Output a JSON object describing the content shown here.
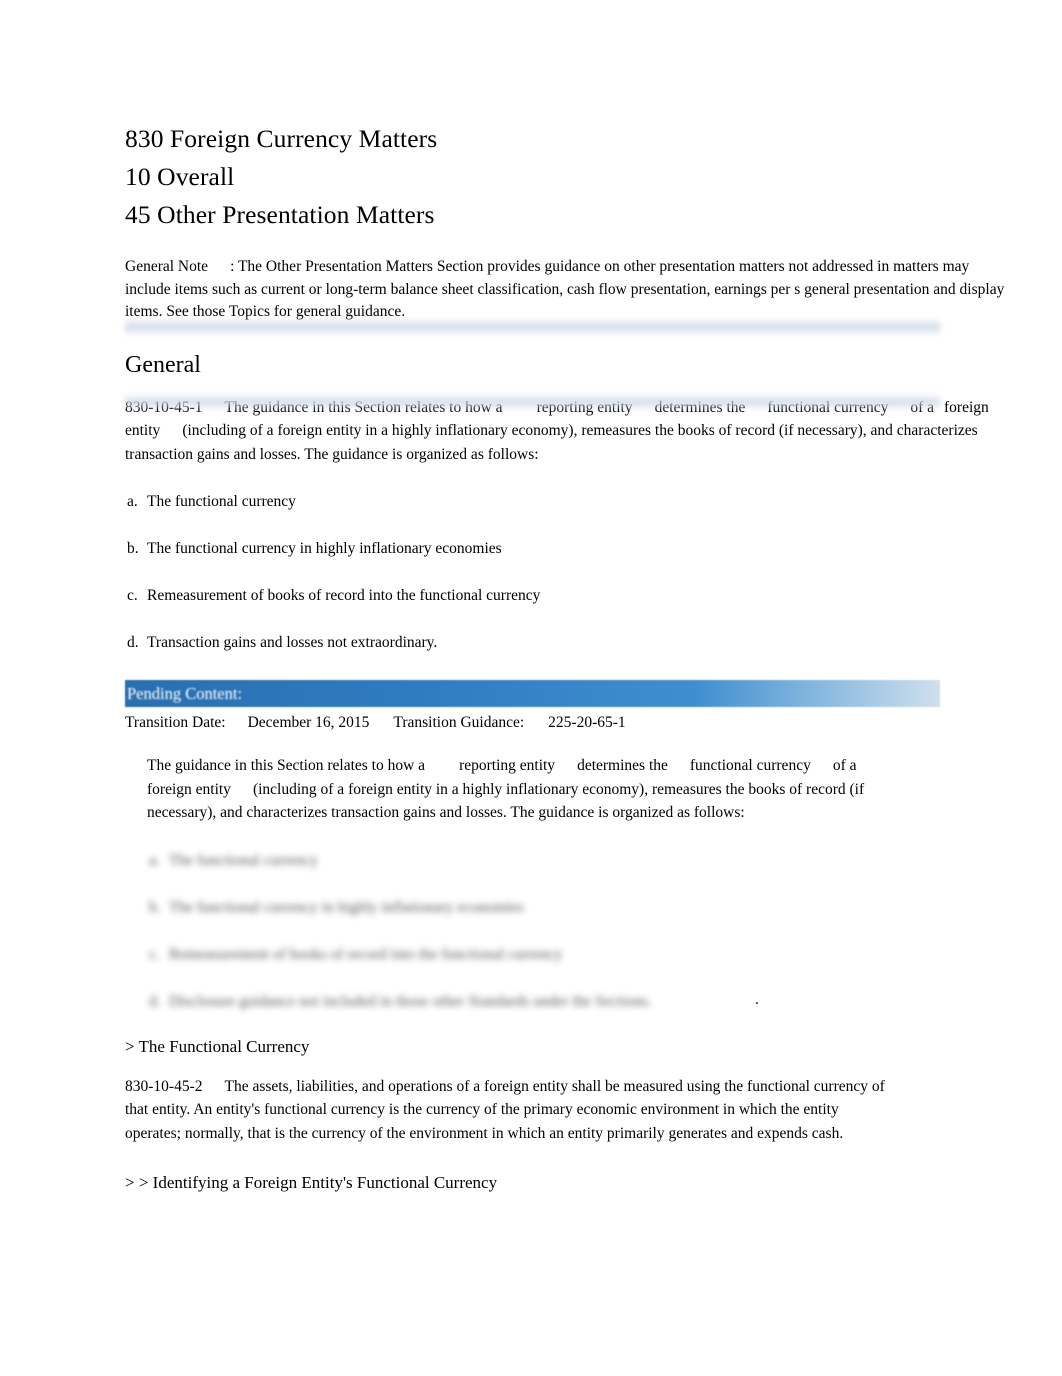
{
  "document": {
    "title_lines": [
      "830 Foreign Currency Matters",
      "10 Overall",
      "45 Other Presentation Matters"
    ],
    "general_note": {
      "label": "General Note",
      "text": ": The Other Presentation Matters Section provides guidance on other presentation matters not addressed in matters may include items such as current or long-term balance sheet classification, cash flow presentation, earnings per s general presentation and display items. See those Topics for general guidance."
    },
    "section_heading": "General",
    "paragraph_45_1": {
      "number": "830-10-45-1",
      "part1": "The guidance in this Section relates to how a",
      "term1": "reporting entity",
      "part2": "determines the",
      "term2": "functional currency",
      "part3": "of a",
      "term3": "foreign entity",
      "part4": "(including of a foreign entity in a highly inflationary economy), remeasures the books of record (if necessary), and characterizes transaction gains and losses. The guidance is organized as follows:"
    },
    "list_items": [
      {
        "marker": "a.",
        "text": "The functional currency"
      },
      {
        "marker": "b.",
        "text": "The functional currency in highly inflationary economies"
      },
      {
        "marker": "c.",
        "text": "Remeasurement of books of record into the functional currency"
      },
      {
        "marker": "d.",
        "text": "Transaction gains and losses not extraordinary."
      }
    ],
    "pending_content": {
      "banner": "Pending Content:",
      "transition_date_label": "Transition Date:",
      "transition_date_value": "December 16, 2015",
      "transition_guidance_label": "Transition Guidance:",
      "transition_guidance_value": "225-20-65-1",
      "body": {
        "part1": "The guidance in this Section relates to how a",
        "term1": "reporting entity",
        "part2": "determines the",
        "term2": "functional currency",
        "part3": "of a",
        "term3": "foreign entity",
        "part4": "(including of a foreign entity in a highly inflationary economy), remeasures the books of record (if necessary), and characterizes transaction gains and losses. The guidance is organized as follows:"
      },
      "list_items": [
        {
          "marker": "a.",
          "text": "The functional currency"
        },
        {
          "marker": "b.",
          "text": "The functional currency in highly inflationary economies"
        },
        {
          "marker": "c.",
          "text": "Remeasurement of books of record into the functional currency"
        },
        {
          "marker": "d.",
          "text": "Disclosure guidance not included in those other Standards under the Sections."
        }
      ]
    },
    "sub_heading": "> The Functional Currency",
    "paragraph_45_2": {
      "number": "830-10-45-2",
      "text": "The assets, liabilities, and operations of a foreign entity shall be measured using the functional currency of that entity. An entity's functional currency is the currency of the primary economic environment in which the entity operates; normally, that is the currency of the environment in which an entity primarily generates and expends cash."
    },
    "sub_sub_heading": "> > Identifying a Foreign Entity's Functional Currency",
    "colors": {
      "pending_banner_start": "#2a6fb0",
      "pending_banner_end": "#cfe0ee",
      "text": "#000000",
      "background": "#ffffff"
    }
  }
}
